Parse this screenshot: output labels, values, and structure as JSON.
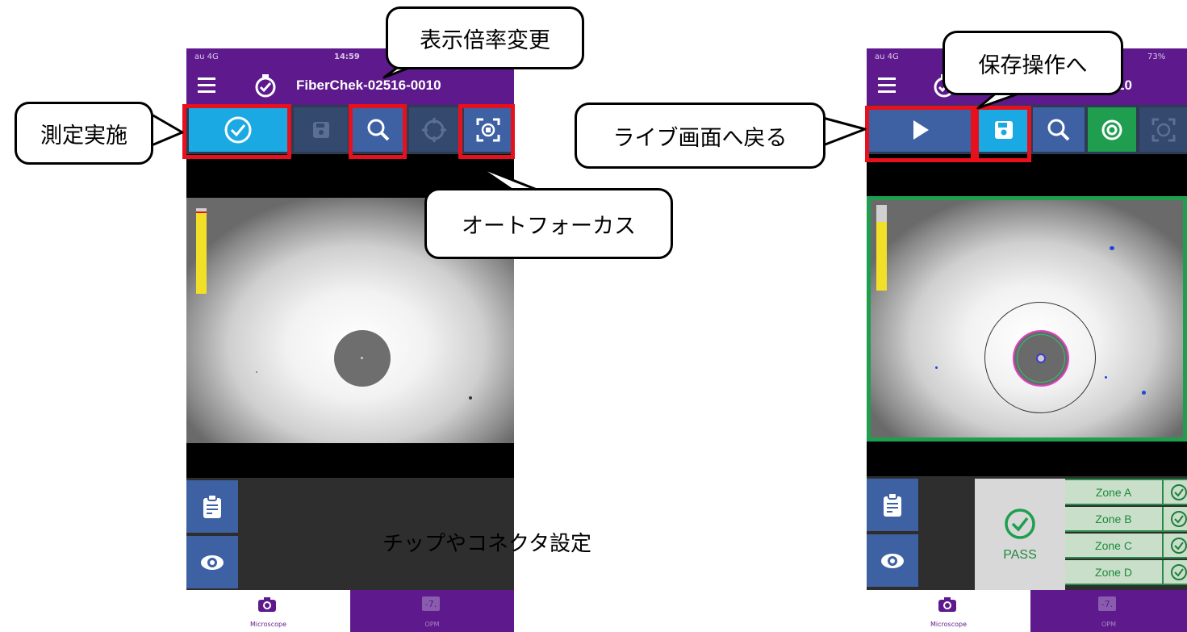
{
  "left_phone": {
    "status": {
      "carrier": "au 4G",
      "time": "14:59"
    },
    "title": "FiberChek-02516-0010",
    "toolbar": {
      "buttons": [
        {
          "name": "measure-button",
          "icon": "check-circle-icon"
        },
        {
          "name": "save-button",
          "icon": "save-icon"
        },
        {
          "name": "zoom-button",
          "icon": "magnifier-icon"
        },
        {
          "name": "target-button",
          "icon": "crosshair-icon"
        },
        {
          "name": "autofocus-button",
          "icon": "autofocus-icon"
        }
      ]
    },
    "focus_level": 0.94,
    "tabs": {
      "microscope": "Microscope",
      "opm": "OPM"
    }
  },
  "right_phone": {
    "status": {
      "carrier": "au 4G",
      "battery": "73%"
    },
    "title_fragment": "10",
    "result": {
      "label": "PASS",
      "color": "#1f8a3f"
    },
    "zones": [
      "Zone A",
      "Zone B",
      "Zone C",
      "Zone D"
    ],
    "tabs": {
      "microscope": "Microscope",
      "opm": "OPM"
    }
  },
  "callouts": {
    "measure": "測定実施",
    "zoom": "表示倍率変更",
    "autofocus": "オートフォーカス",
    "tip_settings": "チップやコネクタ設定",
    "live_back": "ライブ画面へ戻る",
    "save_op": "保存操作へ"
  },
  "colors": {
    "purple": "#5e1a8c",
    "toolbar_blue": "#3d61a3",
    "cyan": "#1aa9e2",
    "red_highlight": "#e8101c",
    "pass_green": "#1e9e4e"
  }
}
